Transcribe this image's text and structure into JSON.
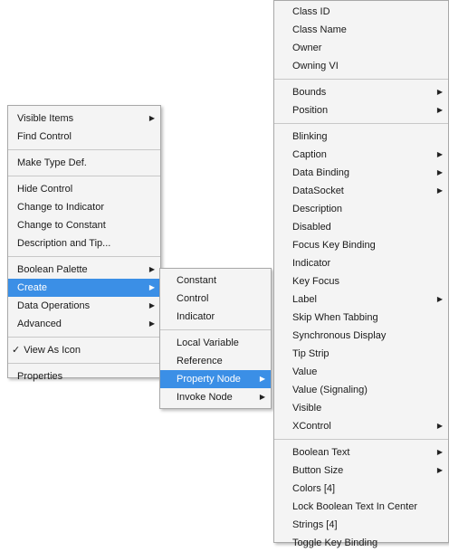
{
  "main_menu": {
    "items": [
      {
        "label": "Visible Items",
        "submenu": true
      },
      {
        "label": "Find Control"
      },
      {
        "label": "Make Type Def."
      },
      {
        "label": "Hide Control"
      },
      {
        "label": "Change to Indicator"
      },
      {
        "label": "Change to Constant"
      },
      {
        "label": "Description and Tip..."
      },
      {
        "label": "Boolean Palette",
        "submenu": true
      },
      {
        "label": "Create",
        "submenu": true,
        "highlighted": true
      },
      {
        "label": "Data Operations",
        "submenu": true
      },
      {
        "label": "Advanced",
        "submenu": true
      },
      {
        "label": "View As Icon",
        "checked": true
      },
      {
        "label": "Properties"
      }
    ]
  },
  "create_menu": {
    "items": [
      {
        "label": "Constant"
      },
      {
        "label": "Control"
      },
      {
        "label": "Indicator"
      },
      {
        "label": "Local Variable"
      },
      {
        "label": "Reference"
      },
      {
        "label": "Property Node",
        "submenu": true,
        "highlighted": true
      },
      {
        "label": "Invoke Node",
        "submenu": true
      }
    ]
  },
  "property_menu": {
    "items": [
      {
        "label": "Class ID"
      },
      {
        "label": "Class Name"
      },
      {
        "label": "Owner"
      },
      {
        "label": "Owning VI"
      },
      {
        "label": "Bounds",
        "submenu": true
      },
      {
        "label": "Position",
        "submenu": true
      },
      {
        "label": "Blinking"
      },
      {
        "label": "Caption",
        "submenu": true
      },
      {
        "label": "Data Binding",
        "submenu": true
      },
      {
        "label": "DataSocket",
        "submenu": true
      },
      {
        "label": "Description"
      },
      {
        "label": "Disabled"
      },
      {
        "label": "Focus Key Binding"
      },
      {
        "label": "Indicator"
      },
      {
        "label": "Key Focus"
      },
      {
        "label": "Label",
        "submenu": true
      },
      {
        "label": "Skip When Tabbing"
      },
      {
        "label": "Synchronous Display"
      },
      {
        "label": "Tip Strip"
      },
      {
        "label": "Value"
      },
      {
        "label": "Value (Signaling)"
      },
      {
        "label": "Visible"
      },
      {
        "label": "XControl",
        "submenu": true
      },
      {
        "label": "Boolean Text",
        "submenu": true
      },
      {
        "label": "Button Size",
        "submenu": true
      },
      {
        "label": "Colors [4]"
      },
      {
        "label": "Lock Boolean Text In Center"
      },
      {
        "label": "Strings [4]"
      },
      {
        "label": "Toggle Key Binding"
      }
    ]
  },
  "glyphs": {
    "arrow": "▶",
    "check": "✓"
  },
  "colors": {
    "highlight": "#3b8fe6",
    "menu_bg": "#f4f4f4",
    "border": "#a8a8a8"
  }
}
